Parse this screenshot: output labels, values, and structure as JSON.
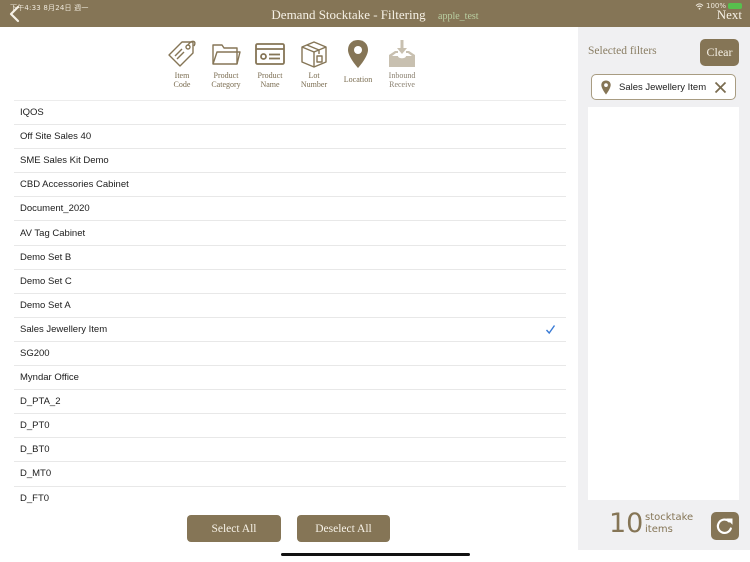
{
  "status_bar": {
    "time": "下午4:33  8月24日 週一",
    "battery": "100%"
  },
  "header": {
    "title": "Demand Stocktake - Filtering",
    "subtitle": "apple_test",
    "back_icon": "chevron-left-icon",
    "next_label": "Next"
  },
  "filter_tabs": [
    {
      "label": "Item\nCode",
      "icon": "tag-icon"
    },
    {
      "label": "Product\nCategory",
      "icon": "folder-icon"
    },
    {
      "label": "Product\nName",
      "icon": "id-card-icon"
    },
    {
      "label": "Lot\nNumber",
      "icon": "box-icon"
    },
    {
      "label": "Location",
      "icon": "map-pin-icon",
      "active": true
    },
    {
      "label": "Inbound\nReceive",
      "icon": "inbox-download-icon",
      "disabled": true
    }
  ],
  "locations": [
    {
      "label": "IQOS",
      "selected": false
    },
    {
      "label": "Off Site Sales 40",
      "selected": false
    },
    {
      "label": "SME Sales Kit Demo",
      "selected": false
    },
    {
      "label": "CBD Accessories Cabinet",
      "selected": false
    },
    {
      "label": "Document_2020",
      "selected": false
    },
    {
      "label": "AV Tag Cabinet",
      "selected": false
    },
    {
      "label": "Demo Set B",
      "selected": false
    },
    {
      "label": "Demo Set C",
      "selected": false
    },
    {
      "label": "Demo Set A",
      "selected": false
    },
    {
      "label": "Sales Jewellery Item",
      "selected": true
    },
    {
      "label": "SG200",
      "selected": false
    },
    {
      "label": "Myndar Office",
      "selected": false
    },
    {
      "label": "D_PTA_2",
      "selected": false
    },
    {
      "label": "D_PT0",
      "selected": false
    },
    {
      "label": "D_BT0",
      "selected": false
    },
    {
      "label": "D_MT0",
      "selected": false
    },
    {
      "label": "D_FT0",
      "selected": false
    }
  ],
  "actions": {
    "select_all": "Select All",
    "deselect_all": "Deselect All"
  },
  "sidebar": {
    "title": "Selected filters",
    "clear_label": "Clear",
    "chips": [
      {
        "label": "Sales Jewellery Item",
        "icon": "map-pin-icon"
      }
    ],
    "count": "10",
    "count_label_line1": "stocktake",
    "count_label_line2": "items"
  },
  "colors": {
    "brand": "#857556",
    "check": "#3a7bd5",
    "sidebar_bg": "#f0f0f2"
  }
}
